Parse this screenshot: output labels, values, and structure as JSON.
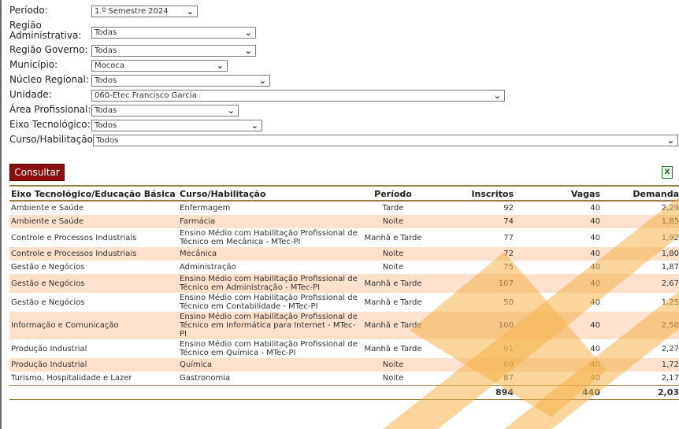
{
  "filters": [
    {
      "label": "Período:",
      "value": "1.º Semestre 2024"
    },
    {
      "label": "Região Administrativa:",
      "value": "Todas"
    },
    {
      "label": "Região Governo:",
      "value": "Todas"
    },
    {
      "label": "Município:",
      "value": "Mococa"
    },
    {
      "label": "Núcleo Regional:",
      "value": "Todos"
    },
    {
      "label": "Unidade:",
      "value": "060-Etec Francisco Garcia"
    },
    {
      "label": "Área Profissional:",
      "value": "Todas"
    },
    {
      "label": "Eixo Tecnológico:",
      "value": "Todos"
    },
    {
      "label": "Curso/Habilitação:",
      "value": "Todos"
    }
  ],
  "consultar_label": "Consultar",
  "export_icon": "excel-export-icon",
  "table": {
    "headers": [
      "Eixo Tecnológico/Educação Básica",
      "Curso/Habilitação",
      "Período",
      "Inscritos",
      "Vagas",
      "Demanda"
    ],
    "rows": [
      [
        "Ambiente e Saúde",
        "Enfermagem",
        "Tarde",
        "92",
        "40",
        "2,29"
      ],
      [
        "Ambiente e Saúde",
        "Farmácia",
        "Noite",
        "74",
        "40",
        "1,85"
      ],
      [
        "Controle e Processos Industriais",
        "Ensino Médio com Habilitação Profissional de Técnico em Mecânica - MTec-PI",
        "Manhã e Tarde",
        "77",
        "40",
        "1,92"
      ],
      [
        "Controle e Processos Industriais",
        "Mecânica",
        "Noite",
        "72",
        "40",
        "1,80"
      ],
      [
        "Gestão e Negócios",
        "Administração",
        "Noite",
        "75",
        "40",
        "1,87"
      ],
      [
        "Gestão e Negócios",
        "Ensino Médio com Habilitação Profissional de Técnico em Administração - MTec-PI",
        "Manhã e Tarde",
        "107",
        "40",
        "2,67"
      ],
      [
        "Gestão e Negócios",
        "Ensino Médio com Habilitação Profissional de Técnico em Contabilidade - MTec-PI",
        "Manhã e Tarde",
        "50",
        "40",
        "1,25"
      ],
      [
        "Informação e Comunicação",
        "Ensino Médio com Habilitação Profissional de Técnico em Informática para Internet - MTec-PI",
        "Manhã e Tarde",
        "100",
        "40",
        "2,50"
      ],
      [
        "Produção Industrial",
        "Ensino Médio com Habilitação Profissional de Técnico em Química - MTec-PI",
        "Manhã e Tarde",
        "91",
        "40",
        "2,27"
      ],
      [
        "Produção Industrial",
        "Química",
        "Noite",
        "69",
        "40",
        "1,72"
      ],
      [
        "Turismo, Hospitalidade e Lazer",
        "Gastronomia",
        "Noite",
        "87",
        "40",
        "2,17"
      ]
    ],
    "totals": {
      "inscritos": "894",
      "vagas": "440",
      "demanda": "2,03"
    }
  },
  "colors": {
    "button": "#8b0d0d",
    "row_alt": "#fde1cc",
    "rule": "#9a7a45",
    "watermark": "#f6b24a"
  }
}
